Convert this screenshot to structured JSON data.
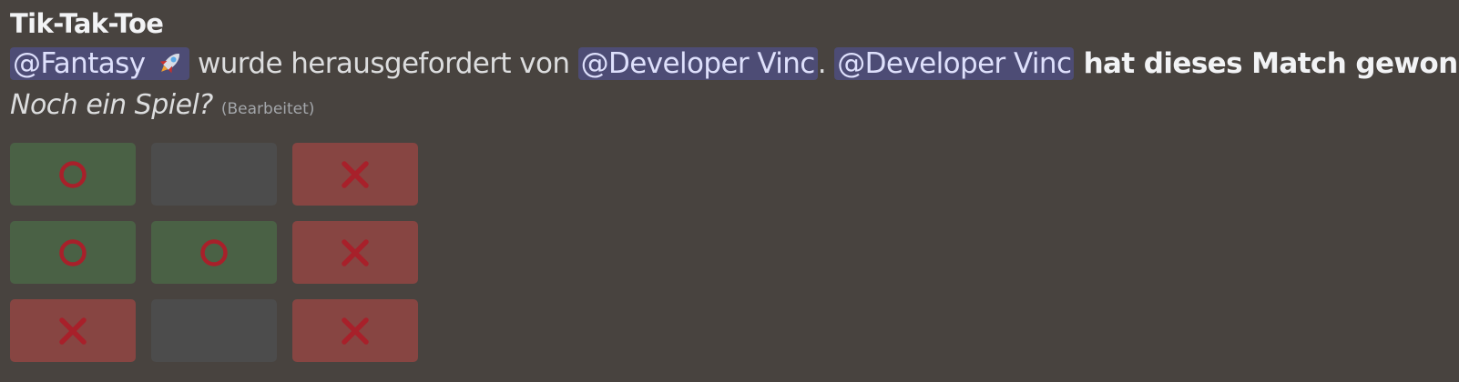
{
  "title": "Tik-Tak-Toe",
  "message": {
    "mention_challenged": "@Fantasy",
    "challenged_emoji": "rocket-icon",
    "challenge_text": " wurde herausgefordert von ",
    "mention_challenger": "@Developer Vinc",
    "separator": ". ",
    "mention_winner": "@Developer Vinc",
    "result_text": " hat dieses Match gewonnen.",
    "replay_prompt": "Noch ein Spiel?",
    "edited_label": "(Bearbeitet)"
  },
  "board": {
    "rows": [
      [
        "O",
        "",
        "X"
      ],
      [
        "O",
        "O",
        "X"
      ],
      [
        "X",
        "",
        "X"
      ]
    ],
    "colors": {
      "o_background": "#4a6145",
      "x_background": "#874542",
      "empty_background": "#4c4c4c",
      "mark_color": "#a8202a"
    }
  }
}
